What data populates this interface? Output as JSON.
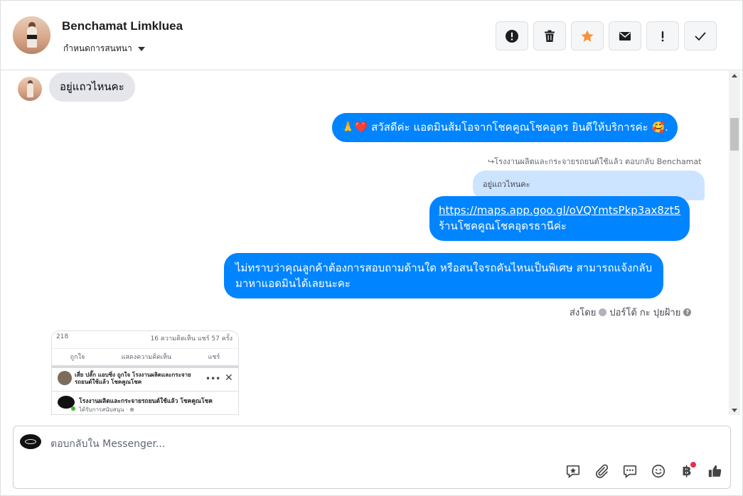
{
  "header": {
    "contact_name": "Benchamat Limkluea",
    "assign_label": "กำหนดการสนทนา",
    "actions": [
      {
        "id": "spam",
        "icon": "alert-circle-icon"
      },
      {
        "id": "delete",
        "icon": "trash-icon"
      },
      {
        "id": "star",
        "icon": "star-icon",
        "color": "#f7923a"
      },
      {
        "id": "mail",
        "icon": "envelope-icon"
      },
      {
        "id": "follow-up",
        "icon": "exclamation-icon"
      },
      {
        "id": "done",
        "icon": "checkmark-icon"
      }
    ]
  },
  "messages": {
    "incoming_1": "อยู่แถวไหนคะ",
    "outgoing_1": {
      "emoji_left": "🙏❤️",
      "text": " สวัสดีค่ะ แอดมินส้มโอจากโชคคูณโชคอุดร ยินดีให้บริการค่ะ ",
      "emoji_right": "🥰."
    },
    "reply_meta": "↪โรงงานผลิตและกระจายรถยนต์ใช้แล้ว ตอบกลับ Benchamat",
    "quoted_text": "อยู่แถวไหนคะ",
    "outgoing_2": {
      "link": "https://maps.app.goo.gl/oVQYmtsPkp3ax8zt5",
      "text": "ร้านโชคคูณโชคอุดรธานีค่ะ"
    },
    "outgoing_3": {
      "line1": "ไม่ทราบว่าคุณลูกค้าต้องการสอบถามด้านใด หรือสนใจรถคันไหนเป็นพิเศษ สามารถแจ้งกลับ",
      "line2": "มาหาแอดมินได้เลยนะคะ"
    },
    "sent_by_prefix": "ส่งโดย",
    "sent_by_name": "ปอร์โต้ กะ ปุยฝ้าย"
  },
  "shared_post": {
    "likes": "218",
    "stats": "16 ความคิดเห็น  แชร์ 57 ครั้ง",
    "like_label": "ถูกใจ",
    "comment_label": "แสดงความคิดเห็น",
    "share_label": "แชร์",
    "commenter_text": "เสี่ย ปลั๊ก แอบซิ่ง ถูกใจ โรงงานผลิตและกระจายรถยนต์ใช้แล้ว โชคคูณโชค",
    "page_name": "โรงงานผลิตและกระจายรถยนต์ใช้แล้ว โชคคูณโชค",
    "sponsor_label": "ได้รับการสนับสนุน · ⊕"
  },
  "composer": {
    "placeholder": "ตอบกลับใน Messenger...",
    "tools": [
      "saved-reply-icon",
      "attachment-icon",
      "message-bubble-icon",
      "emoji-icon",
      "baht-payment-icon",
      "thumbs-up-icon"
    ],
    "baht_symbol": "฿"
  },
  "colors": {
    "outgoing_bubble": "#0084ff",
    "incoming_bubble": "#e4e6eb",
    "quoted_bubble": "#cce4ff",
    "star": "#f7923a",
    "notification_dot": "#f02849"
  }
}
